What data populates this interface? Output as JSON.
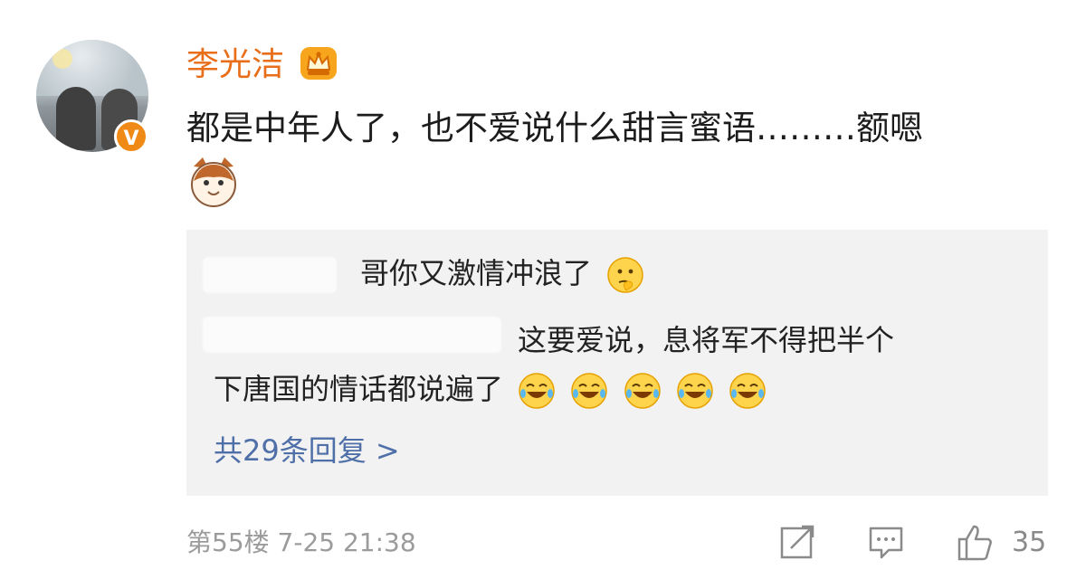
{
  "user": {
    "name": "李光洁",
    "verified_badge": "V",
    "badge_color": "#f08a16",
    "name_color": "#e86e1a"
  },
  "comment": {
    "text": "都是中年人了，也不爱说什么甜言蜜语………额嗯"
  },
  "replies": [
    {
      "text": "哥你又激情冲浪了"
    },
    {
      "text_line1": "这要爱说，息将军不得把半个",
      "text_line2": "下唐国的情话都说遍了"
    }
  ],
  "more_replies_label": "共29条回复 >",
  "meta": {
    "floor_and_time": "第55楼  7-25 21:38",
    "likes": "35"
  },
  "colors": {
    "link": "#4e6fa8",
    "reply_bg": "#f2f2f2",
    "meta": "#9b9b9b"
  }
}
